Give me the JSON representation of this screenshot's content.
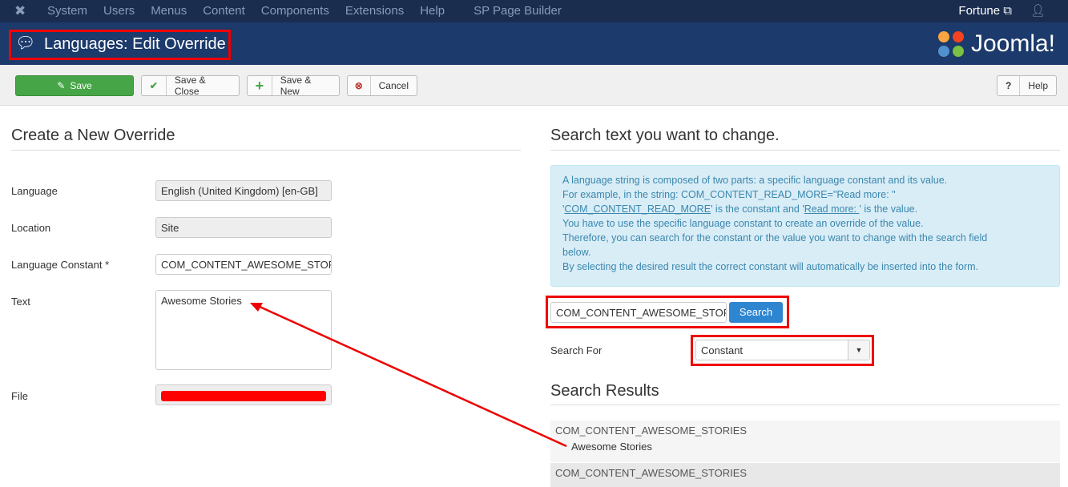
{
  "topbar": {
    "menu": [
      "System",
      "Users",
      "Menus",
      "Content",
      "Components",
      "Extensions",
      "Help",
      "SP Page Builder"
    ],
    "user": "Fortune"
  },
  "header": {
    "title": "Languages: Edit Override",
    "logo_text": "Joomla!"
  },
  "toolbar": {
    "save": "Save",
    "save_close": "Save & Close",
    "save_new": "Save & New",
    "cancel": "Cancel",
    "help": "Help"
  },
  "left": {
    "heading": "Create a New Override",
    "fields": [
      {
        "label": "Language",
        "value": "English (United Kingdom) [en-GB]"
      },
      {
        "label": "Location",
        "value": "Site"
      },
      {
        "label": "Language Constant *",
        "value": "COM_CONTENT_AWESOME_STORIES"
      },
      {
        "label": "Text",
        "value": "Awesome Stories"
      },
      {
        "label": "File",
        "value": ""
      }
    ]
  },
  "right": {
    "heading": "Search text you want to change.",
    "info": {
      "l1": "A language string is composed of two parts: a specific language constant and its value.",
      "l2": "For example, in the string: COM_CONTENT_READ_MORE=\"Read more: \"",
      "l3a": "'",
      "l3b": "COM_CONTENT_READ_MORE",
      "l3c": "' is the constant and '",
      "l3d": "Read more: ",
      "l3e": "' is the value.",
      "l4": "You have to use the specific language constant to create an override of the value.",
      "l5": "Therefore, you can search for the constant or the value you want to change with the search field",
      "l6": "below.",
      "l7": "By selecting the desired result the correct constant will automatically be inserted into the form."
    },
    "search_value": "COM_CONTENT_AWESOME_STORIES",
    "search_button": "Search",
    "search_for_label": "Search For",
    "search_for_value": "Constant",
    "results_heading": "Search Results",
    "results": [
      {
        "constant": "COM_CONTENT_AWESOME_STORIES",
        "value": "Awesome Stories"
      },
      {
        "constant": "COM_CONTENT_AWESOME_STORIES",
        "value": ""
      }
    ]
  }
}
